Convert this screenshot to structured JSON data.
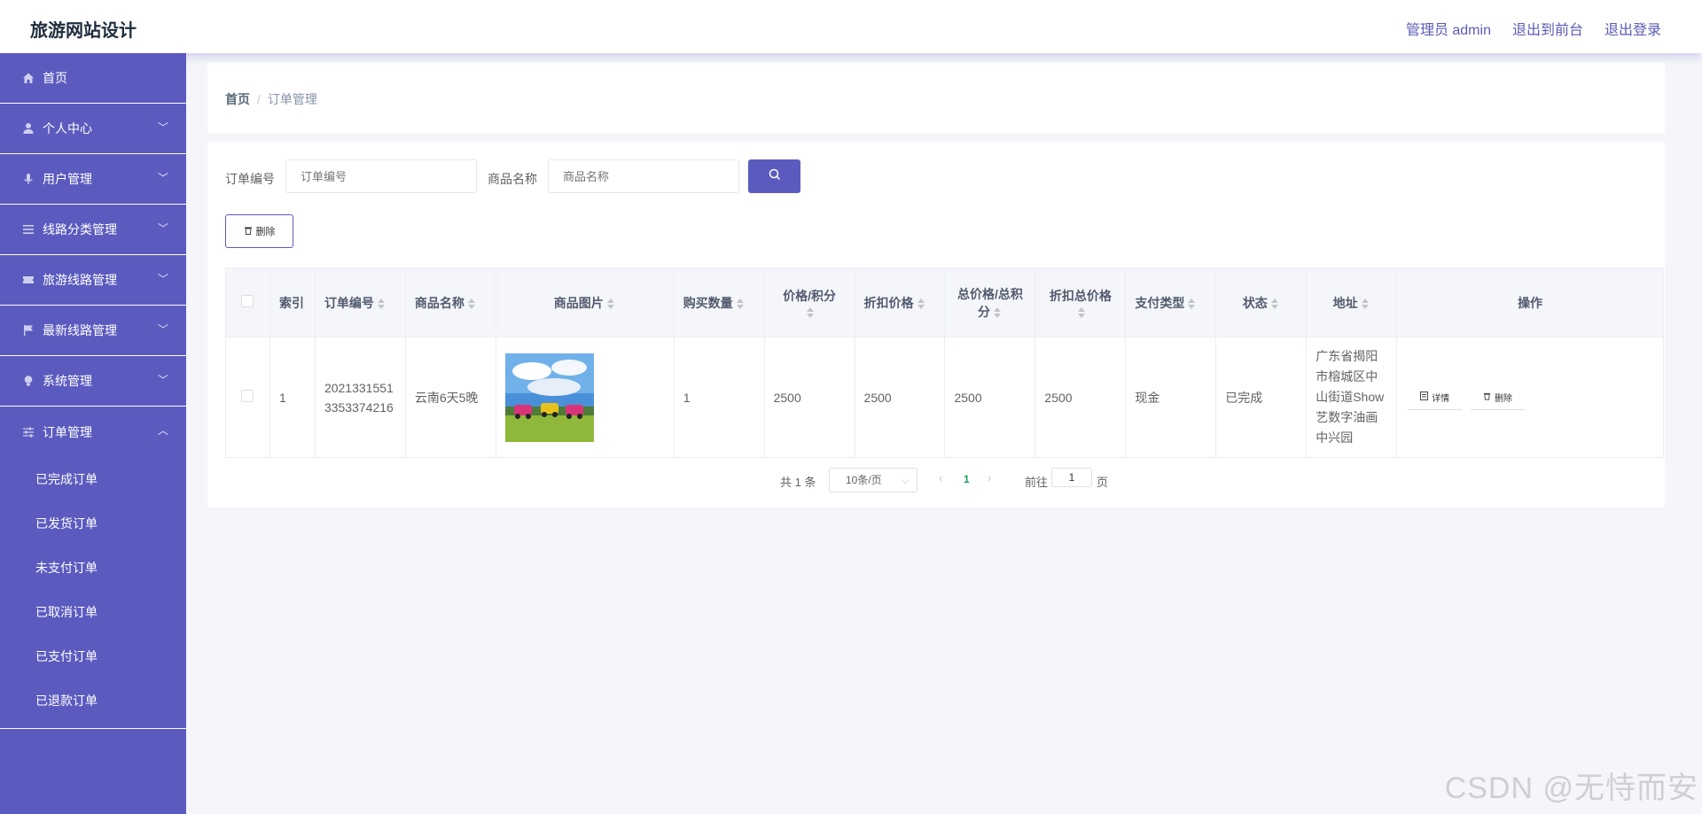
{
  "app": {
    "title": "旅游网站设计"
  },
  "topnav": {
    "admin": "管理员 admin",
    "front": "退出到前台",
    "logout": "退出登录"
  },
  "sidebar": {
    "items": [
      {
        "label": "首页",
        "icon": "home-icon"
      },
      {
        "label": "个人中心",
        "icon": "user-icon"
      },
      {
        "label": "用户管理",
        "icon": "microphone-icon"
      },
      {
        "label": "线路分类管理",
        "icon": "list-icon"
      },
      {
        "label": "旅游线路管理",
        "icon": "ticket-icon"
      },
      {
        "label": "最新线路管理",
        "icon": "flag-icon"
      },
      {
        "label": "系统管理",
        "icon": "bulb-icon"
      },
      {
        "label": "订单管理",
        "icon": "sliders-icon"
      }
    ],
    "submenu": [
      "已完成订单",
      "已发货订单",
      "未支付订单",
      "已取消订单",
      "已支付订单",
      "已退款订单"
    ]
  },
  "breadcrumb": {
    "home": "首页",
    "current": "订单管理"
  },
  "filters": {
    "order_no_label": "订单编号",
    "order_no_placeholder": "订单编号",
    "product_label": "商品名称",
    "product_placeholder": "商品名称"
  },
  "actions": {
    "delete": "删除"
  },
  "table": {
    "headers": [
      "索引",
      "订单编号",
      "商品名称",
      "商品图片",
      "购买数量",
      "价格/积分",
      "折扣价格",
      "总价格/总积分",
      "折扣总价格",
      "支付类型",
      "状态",
      "地址",
      "操作"
    ],
    "rows": [
      {
        "index": "1",
        "order_no": "20213315513353374216",
        "product": "云南6天5晚",
        "qty": "1",
        "price": "2500",
        "discount_price": "2500",
        "total": "2500",
        "discount_total": "2500",
        "pay_type": "现金",
        "status": "已完成",
        "address": "广东省揭阳市榕城区中山街道Show艺数字油画中兴园",
        "detail_label": "详情",
        "delete_label": "删除"
      }
    ]
  },
  "pager": {
    "total": "共 1 条",
    "size": "10条/页",
    "current": "1",
    "goto": "前往",
    "jump_value": "1",
    "page": "页"
  },
  "watermark": "CSDN @无恃而安",
  "colors": {
    "accent": "#5b5bbf",
    "page_active": "#18a058"
  }
}
